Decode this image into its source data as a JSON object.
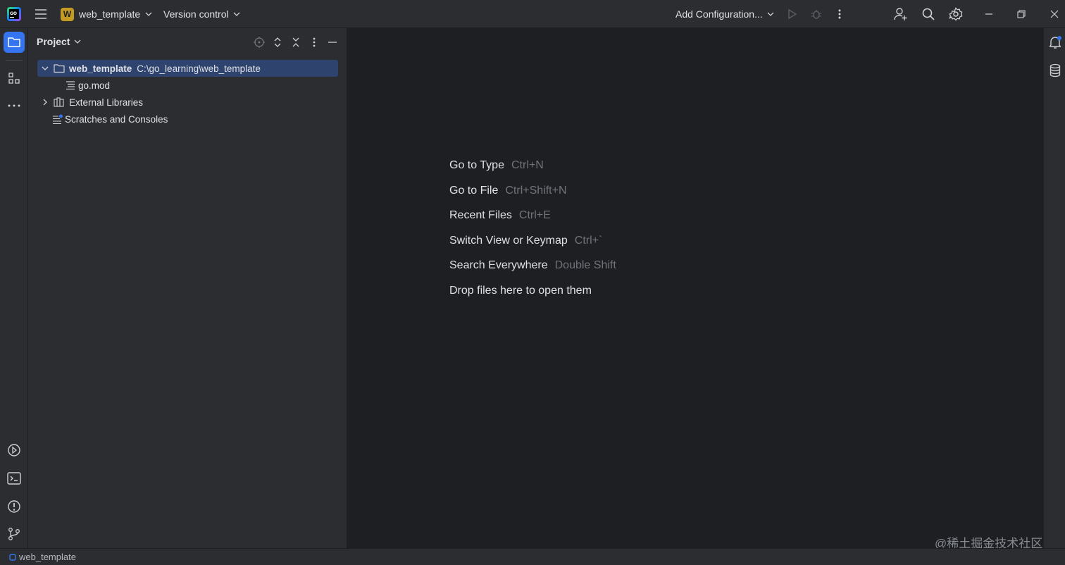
{
  "colors": {
    "accent": "#3574f0",
    "selection": "#2e436e",
    "editor_bg": "#1e1f22",
    "panel_bg": "#2b2d30",
    "project_badge": "#c29a24"
  },
  "titlebar": {
    "project_badge_letter": "W",
    "project_name": "web_template",
    "vcs_label": "Version control",
    "run_config_label": "Add Configuration...",
    "icons": [
      "goland-logo-icon",
      "hamburger-menu-icon",
      "chevron-down-icon",
      "run-icon",
      "debug-icon",
      "more-vertical-icon",
      "add-user-icon",
      "search-icon",
      "gear-icon",
      "minimize-icon",
      "restore-icon",
      "close-icon"
    ]
  },
  "left_strip": {
    "icons": [
      "project-folder-icon",
      "structure-icon",
      "more-horizontal-icon",
      "run-services-icon",
      "terminal-icon",
      "problems-icon",
      "git-branch-icon"
    ]
  },
  "project_panel": {
    "title": "Project",
    "tree": [
      {
        "label": "web_template",
        "path": "C:\\go_learning\\web_template",
        "expanded": true,
        "selected": true,
        "icon": "folder-icon"
      },
      {
        "label": "go.mod",
        "icon": "text-file-icon"
      },
      {
        "label": "External Libraries",
        "expanded": false,
        "icon": "library-icon"
      },
      {
        "label": "Scratches and Consoles",
        "icon": "scratches-icon"
      }
    ]
  },
  "editor": {
    "hints": [
      {
        "label": "Go to Type",
        "keys": "Ctrl+N"
      },
      {
        "label": "Go to File",
        "keys": "Ctrl+Shift+N"
      },
      {
        "label": "Recent Files",
        "keys": "Ctrl+E"
      },
      {
        "label": "Switch View or Keymap",
        "keys": "Ctrl+`"
      },
      {
        "label": "Search Everywhere",
        "keys": "Double Shift"
      },
      {
        "label": "Drop files here to open them",
        "keys": ""
      }
    ]
  },
  "right_strip": {
    "icons": [
      "notifications-icon",
      "database-icon"
    ]
  },
  "statusbar": {
    "breadcrumb": "web_template"
  },
  "watermark": "@稀土掘金技术社区"
}
